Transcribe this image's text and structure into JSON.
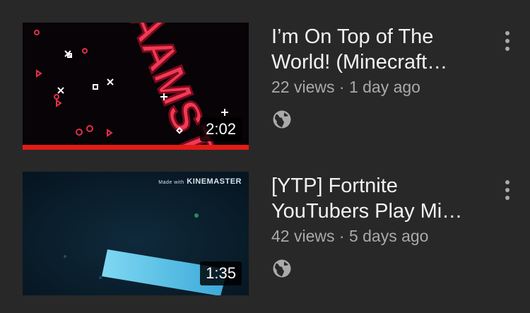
{
  "videos": [
    {
      "title_line1": "I’m On Top of The",
      "title_line2": "World! (Minecraft…",
      "views": "22 views",
      "age": "1 day ago",
      "duration": "2:02",
      "watched_fraction": 1.0,
      "visibility_icon": "globe-icon",
      "thumbnail_text": "AAMSTA"
    },
    {
      "title_line1": "[YTP] Fortnite",
      "title_line2": "YouTubers Play Mi…",
      "views": "42 views",
      "age": "5 days ago",
      "duration": "1:35",
      "visibility_icon": "globe-icon",
      "watermark_prefix": "Made with",
      "watermark_brand": "KINEMASTER"
    }
  ],
  "meta_separator": "·",
  "colors": {
    "background": "#282828",
    "title": "#f1f1f1",
    "meta": "#aaaaaa",
    "progress": "#e41b17"
  }
}
